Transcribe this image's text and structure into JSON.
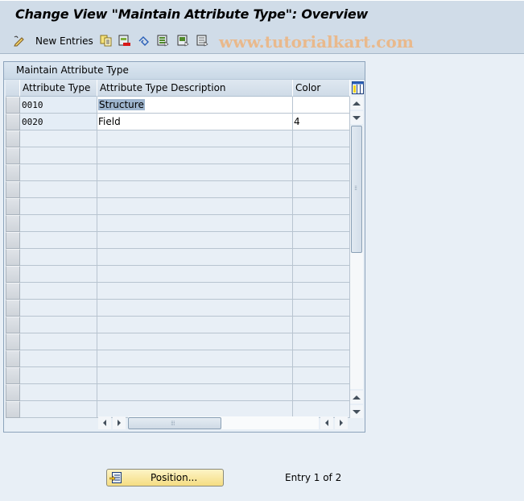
{
  "window": {
    "title": "Change View \"Maintain Attribute Type\": Overview"
  },
  "toolbar": {
    "new_entries_label": "New Entries",
    "icons": [
      "display-change-icon",
      "copy-as-icon",
      "delete-icon",
      "undo-change-icon",
      "select-all-icon",
      "select-block-icon",
      "deselect-all-icon"
    ],
    "watermark": "www.tutorialkart.com"
  },
  "table": {
    "panel_title": "Maintain Attribute Type",
    "columns": [
      "Attribute Type",
      "Attribute Type Description",
      "Color"
    ],
    "rows": [
      {
        "attribute_type": "0010",
        "description": "Structure",
        "color": ""
      },
      {
        "attribute_type": "0020",
        "description": "Field",
        "color": "4"
      }
    ],
    "visible_row_count": 19
  },
  "footer": {
    "position_button_label": "Position...",
    "entry_status": "Entry 1 of 2"
  }
}
